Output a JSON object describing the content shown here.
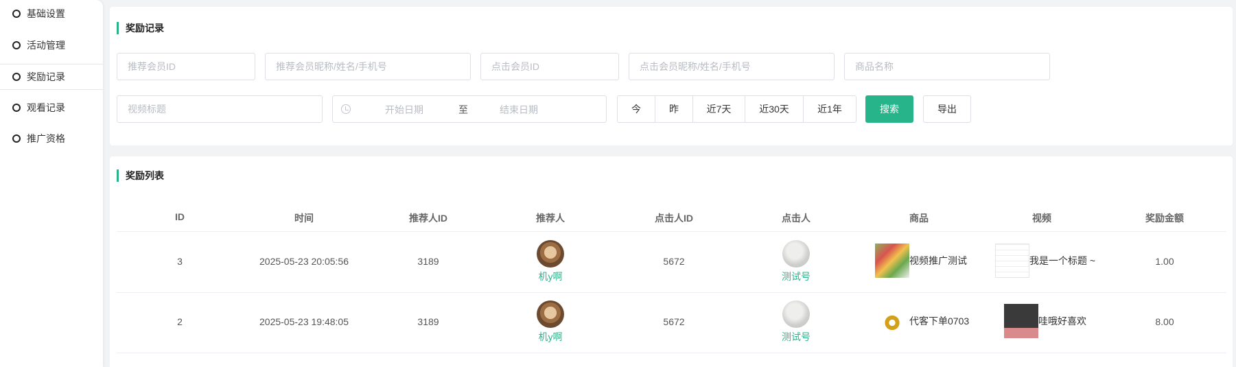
{
  "sidebar": {
    "items": [
      {
        "label": "基础设置"
      },
      {
        "label": "活动管理"
      },
      {
        "label": "奖励记录"
      },
      {
        "label": "观看记录"
      },
      {
        "label": "推广资格"
      }
    ]
  },
  "filter": {
    "title": "奖励记录",
    "referrer_id_placeholder": "推荐会员ID",
    "referrer_info_placeholder": "推荐会员昵称/姓名/手机号",
    "clicker_id_placeholder": "点击会员ID",
    "clicker_info_placeholder": "点击会员昵称/姓名/手机号",
    "product_name_placeholder": "商品名称",
    "video_title_placeholder": "视频标题",
    "start_date_placeholder": "开始日期",
    "date_separator": "至",
    "end_date_placeholder": "结束日期",
    "quick_ranges": [
      "今",
      "昨",
      "近7天",
      "近30天",
      "近1年"
    ],
    "search_label": "搜索",
    "export_label": "导出"
  },
  "list": {
    "title": "奖励列表",
    "columns": [
      "ID",
      "时间",
      "推荐人ID",
      "推荐人",
      "点击人ID",
      "点击人",
      "商品",
      "视频",
      "奖励金额"
    ],
    "rows": [
      {
        "id": "3",
        "time": "2025-05-23 20:05:56",
        "referrer_id": "3189",
        "referrer": "机y啊",
        "clicker_id": "5672",
        "clicker": "测试号",
        "product": "视频推广测试",
        "video": "我是一个标题 ~",
        "amount": "1.00"
      },
      {
        "id": "2",
        "time": "2025-05-23 19:48:05",
        "referrer_id": "3189",
        "referrer": "机y啊",
        "clicker_id": "5672",
        "clicker": "测试号",
        "product": "代客下单0703",
        "video": "哇哦好喜欢",
        "amount": "8.00"
      }
    ]
  },
  "colors": {
    "accent": "#27b48a"
  }
}
